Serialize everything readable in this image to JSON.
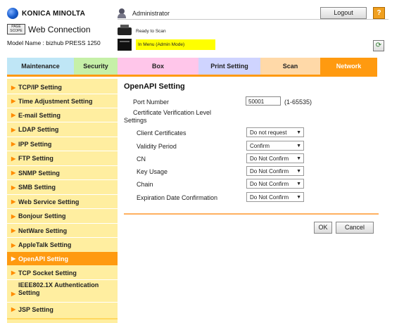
{
  "header": {
    "brand": "KONICA MINOLTA",
    "pswc_badge_line1": "PAGE",
    "pswc_badge_line2": "SCOPE",
    "pswc_title": "Web Connection",
    "model_label": "Model Name : bizhub PRESS 1250",
    "user": "Administrator",
    "logout_label": "Logout",
    "help_label": "?",
    "status_ready": "Ready to Scan",
    "status_mode": "In Menu (Admin Mode)",
    "refresh_label": "⟳"
  },
  "tabs": [
    {
      "label": "Maintenance"
    },
    {
      "label": "Security"
    },
    {
      "label": "Box"
    },
    {
      "label": "Print Setting"
    },
    {
      "label": "Scan"
    },
    {
      "label": "Network",
      "active": true
    }
  ],
  "sidebar": {
    "items": [
      {
        "label": "TCP/IP Setting"
      },
      {
        "label": "Time Adjustment Setting"
      },
      {
        "label": "E-mail Setting"
      },
      {
        "label": "LDAP Setting"
      },
      {
        "label": "IPP Setting"
      },
      {
        "label": "FTP Setting"
      },
      {
        "label": "SNMP Setting"
      },
      {
        "label": "SMB Setting"
      },
      {
        "label": "Web Service Setting"
      },
      {
        "label": "Bonjour Setting"
      },
      {
        "label": "NetWare Setting"
      },
      {
        "label": "AppleTalk Setting"
      },
      {
        "label": "OpenAPI Setting",
        "active": true
      },
      {
        "label": "TCP Socket Setting"
      },
      {
        "label_line1": "IEEE802.1X Authentication",
        "label_line2": "Setting"
      },
      {
        "label": "JSP Setting"
      }
    ]
  },
  "main": {
    "title": "OpenAPI Setting",
    "port_label": "Port Number",
    "port_value": "50001",
    "port_range": "(1-65535)",
    "cert_label_line1": "Certificate Verification Level",
    "cert_label_line2": "Settings",
    "settings": [
      {
        "label": "Client Certificates",
        "value": "Do not request"
      },
      {
        "label": "Validity Period",
        "value": "Confirm"
      },
      {
        "label": "CN",
        "value": "Do Not Confirm"
      },
      {
        "label": "Key Usage",
        "value": "Do Not Confirm"
      },
      {
        "label": "Chain",
        "value": "Do Not Confirm"
      },
      {
        "label": "Expiration Date Confirmation",
        "value": "Do Not Confirm"
      }
    ],
    "ok_label": "OK",
    "cancel_label": "Cancel"
  },
  "colors": {
    "network_tab": "#ff9a10",
    "sidebar_bg": "#ffeea0",
    "status_bar": "#ffff00"
  }
}
